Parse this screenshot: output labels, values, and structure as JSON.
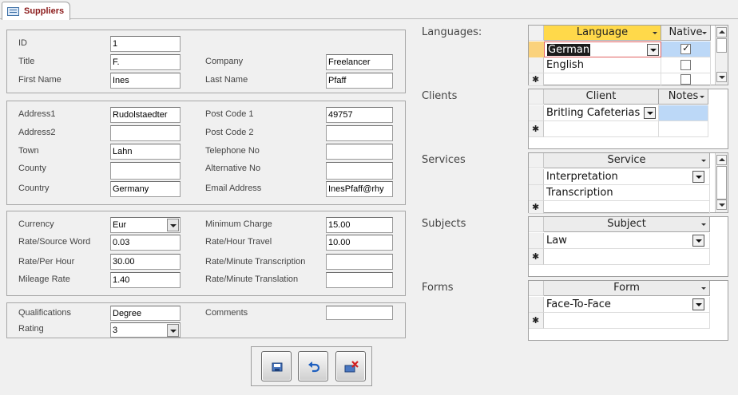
{
  "tab": {
    "title": "Suppliers",
    "icon": "form-icon"
  },
  "fields": {
    "id": {
      "label": "ID",
      "value": "1"
    },
    "title": {
      "label": "Title",
      "value": "F."
    },
    "company": {
      "label": "Company",
      "value": "Freelancer"
    },
    "first_name": {
      "label": "First Name",
      "value": "Ines"
    },
    "last_name": {
      "label": "Last Name",
      "value": "Pfaff"
    },
    "address1": {
      "label": "Address1",
      "value": "Rudolstaedter"
    },
    "post_code_1": {
      "label": "Post Code 1",
      "value": "49757"
    },
    "address2": {
      "label": "Address2",
      "value": ""
    },
    "post_code_2": {
      "label": "Post Code 2",
      "value": ""
    },
    "town": {
      "label": "Town",
      "value": "Lahn"
    },
    "telephone": {
      "label": "Telephone No",
      "value": ""
    },
    "county": {
      "label": "County",
      "value": ""
    },
    "alternative": {
      "label": "Alternative No",
      "value": ""
    },
    "country": {
      "label": "Country",
      "value": "Germany"
    },
    "email": {
      "label": "Email Address",
      "value": "InesPfaff@rhy"
    },
    "currency": {
      "label": "Currency",
      "value": "Eur"
    },
    "minimum_charge": {
      "label": "Minimum Charge",
      "value": "15.00"
    },
    "rate_source_word": {
      "label": "Rate/Source Word",
      "value": "0.03"
    },
    "rate_hour_travel": {
      "label": "Rate/Hour Travel",
      "value": "10.00"
    },
    "rate_per_hour": {
      "label": "Rate/Per Hour",
      "value": "30.00"
    },
    "rate_minute_transcription": {
      "label": "Rate/Minute Transcription",
      "value": ""
    },
    "mileage_rate": {
      "label": "Mileage Rate",
      "value": "1.40"
    },
    "rate_minute_translation": {
      "label": "Rate/Minute Translation",
      "value": ""
    },
    "qualifications": {
      "label": "Qualifications",
      "value": "Degree"
    },
    "comments": {
      "label": "Comments",
      "value": ""
    },
    "rating": {
      "label": "Rating",
      "value": "3"
    }
  },
  "subforms": {
    "languages": {
      "label": "Languages:",
      "columns": [
        "Language",
        "Native"
      ],
      "rows": [
        {
          "value": "German",
          "native": true
        },
        {
          "value": "English",
          "native": false
        }
      ]
    },
    "clients": {
      "label": "Clients",
      "columns": [
        "Client",
        "Notes"
      ],
      "rows": [
        {
          "value": "Britling Cafeterias",
          "notes": ""
        }
      ]
    },
    "services": {
      "label": "Services",
      "columns": [
        "Service"
      ],
      "rows": [
        {
          "value": "Interpretation"
        },
        {
          "value": "Transcription"
        }
      ]
    },
    "subjects": {
      "label": "Subjects",
      "columns": [
        "Subject"
      ],
      "rows": [
        {
          "value": "Law"
        }
      ]
    },
    "forms": {
      "label": "Forms",
      "columns": [
        "Form"
      ],
      "rows": [
        {
          "value": "Face-To-Face"
        }
      ]
    }
  },
  "buttons": [
    {
      "name": "save-record-button",
      "icon": "save-icon"
    },
    {
      "name": "undo-button",
      "icon": "undo-icon"
    },
    {
      "name": "delete-record-button",
      "icon": "delete-icon"
    }
  ],
  "colors": {
    "active_header": "#ffd94a",
    "selected_cell": "#bcd8f7",
    "tab_text": "#8b1a1a"
  }
}
